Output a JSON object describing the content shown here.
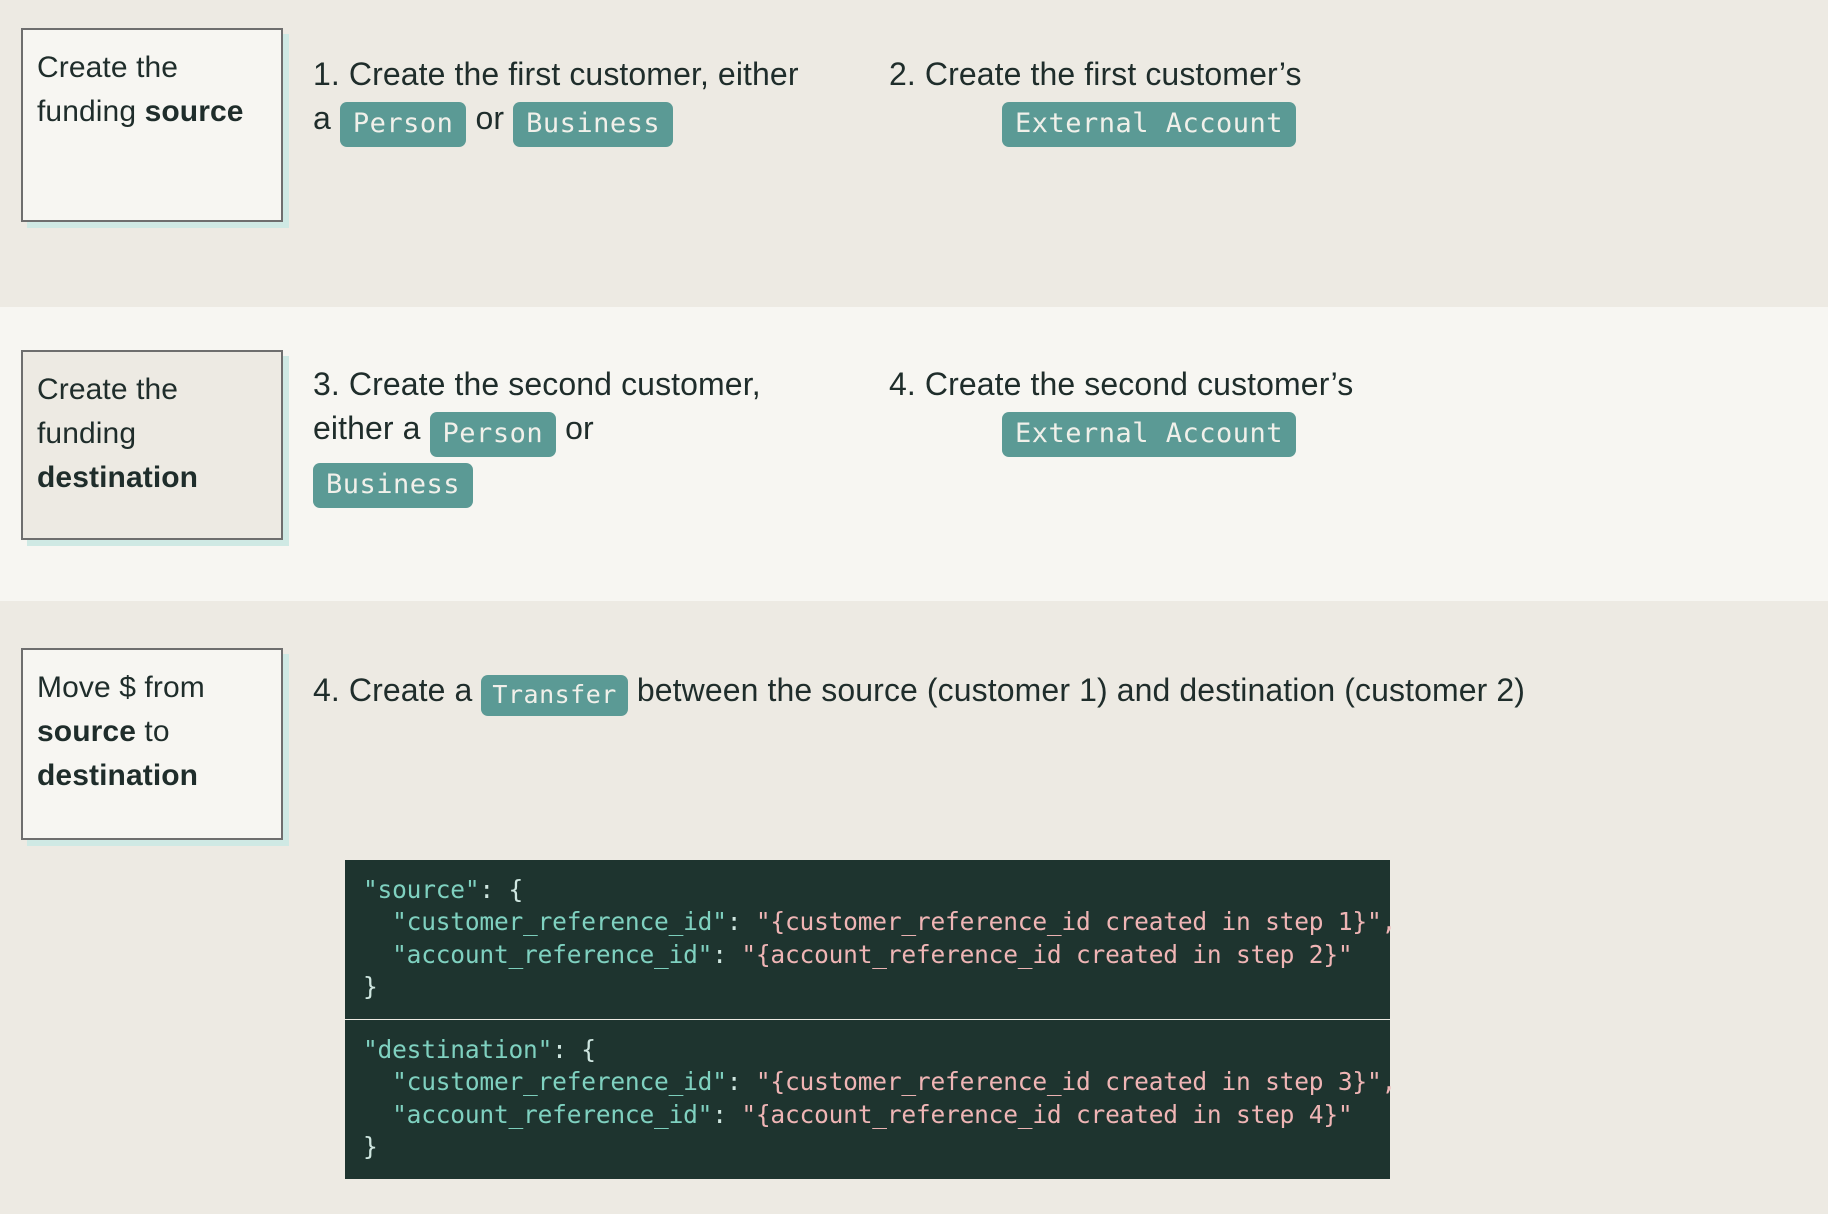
{
  "colors": {
    "band_dark": "#edeae3",
    "band_light": "#f7f6f2",
    "pill_teal": "#5b9a95",
    "card_shadow": "#cfe9e4",
    "code_bg": "#1e342f",
    "code_key": "#7fd1c0",
    "code_value": "#efb5b5",
    "text": "#1f2d2b"
  },
  "sections": [
    {
      "card": {
        "line1": "Create the",
        "line2_plain": "funding ",
        "line2_bold": "source"
      },
      "steps": [
        {
          "number": "1.",
          "text_before": "1. Create the first customer, either",
          "line2_lead": "a",
          "pills": [
            "Person",
            "Business"
          ],
          "between": "or"
        },
        {
          "number": "2.",
          "text_before": "2. Create the first customer’s",
          "pills": [
            "External Account"
          ]
        }
      ]
    },
    {
      "card": {
        "line1": "Create the",
        "line2": "funding",
        "line3_bold": "destination"
      },
      "steps": [
        {
          "number": "3.",
          "text_before": "3. Create the second customer,",
          "line2_lead": "either a",
          "pills": [
            "Person",
            "Business"
          ],
          "between": "or"
        },
        {
          "number": "4.",
          "text_before": "4. Create the second customer’s",
          "pills": [
            "External Account"
          ]
        }
      ]
    },
    {
      "card": {
        "line1": "Move $ from",
        "line2_bold": "source",
        "line2_plain": " to",
        "line3_bold": "destination"
      },
      "transfer_step": {
        "lead": "4. Create a",
        "pill": "Transfer",
        "tail": "between the source (customer 1) and destination (customer 2)"
      },
      "code_blocks": [
        {
          "name": "source",
          "lines": [
            {
              "key": "\"source\"",
              "punct": ": {"
            },
            {
              "indent": "  ",
              "key": "\"customer_reference_id\"",
              "punct": ": ",
              "value": "\"{customer_reference_id created in step 1}\"",
              "trail": ","
            },
            {
              "indent": "  ",
              "key": "\"account_reference_id\"",
              "punct": ": ",
              "value": "\"{account_reference_id created in step 2}\"",
              "trail": ""
            },
            {
              "punct": "}"
            }
          ]
        },
        {
          "name": "destination",
          "lines": [
            {
              "key": "\"destination\"",
              "punct": ": {"
            },
            {
              "indent": "  ",
              "key": "\"customer_reference_id\"",
              "punct": ": ",
              "value": "\"{customer_reference_id created in step 3}\"",
              "trail": ","
            },
            {
              "indent": "  ",
              "key": "\"account_reference_id\"",
              "punct": ": ",
              "value": "\"{account_reference_id created in step 4}\"",
              "trail": ""
            },
            {
              "punct": "}"
            }
          ]
        }
      ]
    }
  ],
  "text": {
    "s1_step1_l1": "1. Create the first customer, either",
    "s1_step1_l2_a": "a",
    "s1_step1_or": "or",
    "s1_step1_pill1": "Person",
    "s1_step1_pill2": "Business",
    "s1_step2_l1": "2. Create the first customer’s",
    "s1_step2_pill": "External Account",
    "s2_step3_l1": "3. Create the second customer,",
    "s2_step3_l2_a": "either a",
    "s2_step3_or": "or",
    "s2_step3_pill1": "Person",
    "s2_step3_pill2": "Business",
    "s2_step4_l1": "4. Create the second customer’s",
    "s2_step4_pill": "External Account",
    "s3_lead": "4. Create a",
    "s3_pill": "Transfer",
    "s3_tail": "between the source (customer 1) and destination (customer 2)",
    "card1_l1": "Create the",
    "card1_l2_plain": "funding ",
    "card1_l2_bold": "source",
    "card2_l1": "Create the",
    "card2_l2": "funding",
    "card2_l3_bold": "destination",
    "card3_l1": "Move $ from",
    "card3_l2_bold": "source",
    "card3_l2_plain": " to",
    "card3_l3_bold": "destination",
    "code1_k0": "\"source\"",
    "code1_p0": ": {",
    "code1_k1": "\"customer_reference_id\"",
    "code1_v1": "\"{customer_reference_id created in step 1}\"",
    "code1_t1": ",",
    "code1_k2": "\"account_reference_id\"",
    "code1_v2": "\"{account_reference_id created in step 2}\"",
    "code1_close": "}",
    "code2_k0": "\"destination\"",
    "code2_p0": ": {",
    "code2_k1": "\"customer_reference_id\"",
    "code2_v1": "\"{customer_reference_id created in step 3}\"",
    "code2_t1": ",",
    "code2_k2": "\"account_reference_id\"",
    "code2_v2": "\"{account_reference_id created in step 4}\"",
    "code2_close": "}",
    "colon_space": ": "
  }
}
